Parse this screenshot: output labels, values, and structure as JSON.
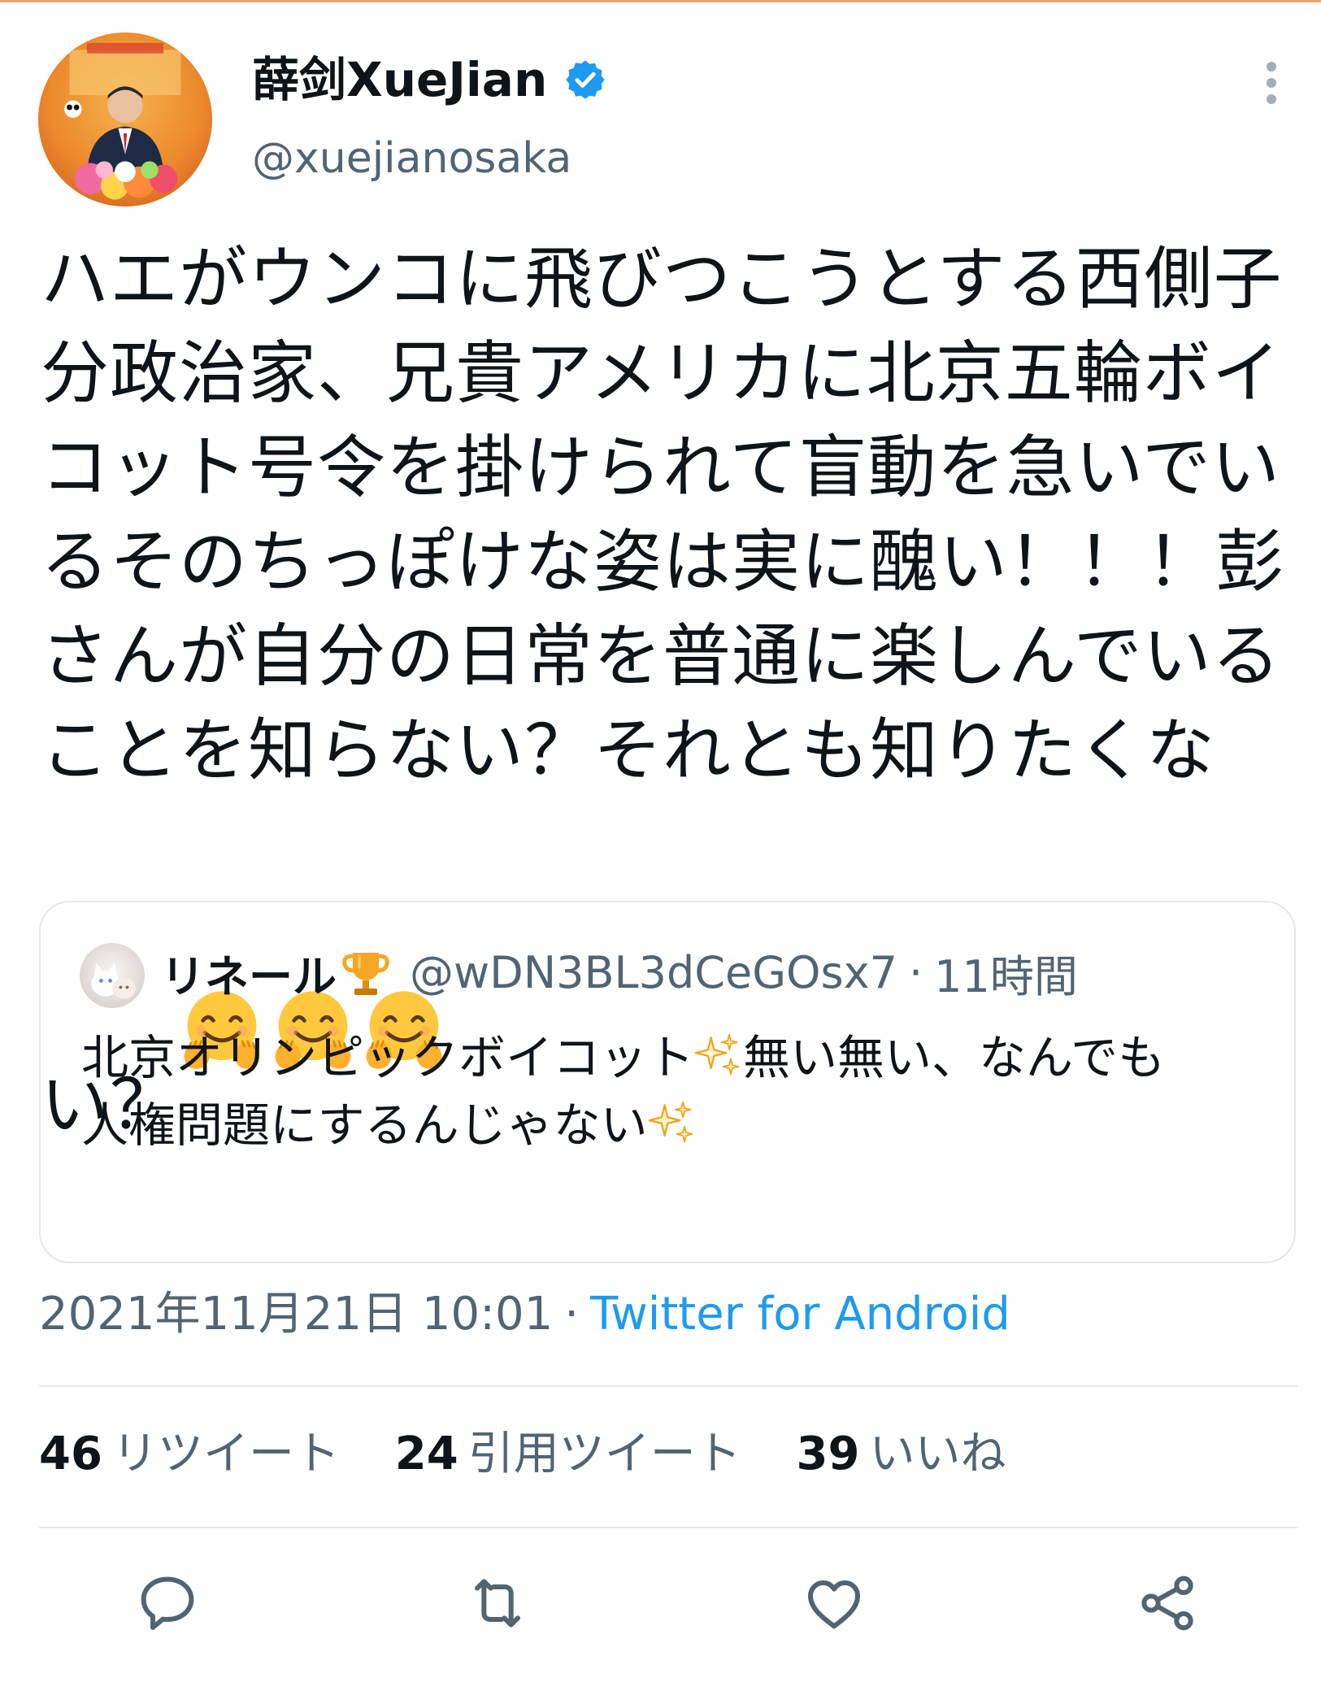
{
  "author": {
    "display_name": "薛剑XueJian",
    "handle": "@xuejianosaka",
    "verified": true
  },
  "tweet": {
    "text": "ハエがウンコに飛びつこうとする西側子分政治家、兄貴アメリカに北京五輪ボイコット号令を掛けられて盲動を急いでいるそのちっぽけな姿は実に醜い！！！彭さんが自分の日常を普通に楽しんでいることを知らない？それとも知りたくない？",
    "emoji": [
      "hugging-face",
      "hugging-face",
      "hugging-face"
    ]
  },
  "quoted_tweet": {
    "name": "リネール",
    "handle": "@wDN3BL3dCeGOsx7",
    "separator": "·",
    "time": "11時間",
    "line1": "北京オリンピックボイコット",
    "line1_after": "無い無い、なんでも",
    "line2": "人権問題にするんじゃない"
  },
  "meta": {
    "timestamp": "2021年11月21日 10:01",
    "separator": "·",
    "source": "Twitter for Android"
  },
  "stats": {
    "retweets": {
      "count": "46",
      "label": "リツイート"
    },
    "quotes": {
      "count": "24",
      "label": "引用ツイート"
    },
    "likes": {
      "count": "39",
      "label": "いいね"
    }
  },
  "actions": [
    "reply-icon",
    "retweet-icon",
    "like-icon",
    "share-icon"
  ],
  "colors": {
    "link": "#1d9bf0",
    "secondary_text": "#536471",
    "verified": "#1d9bf0",
    "accent_top": "#e8a27a"
  }
}
